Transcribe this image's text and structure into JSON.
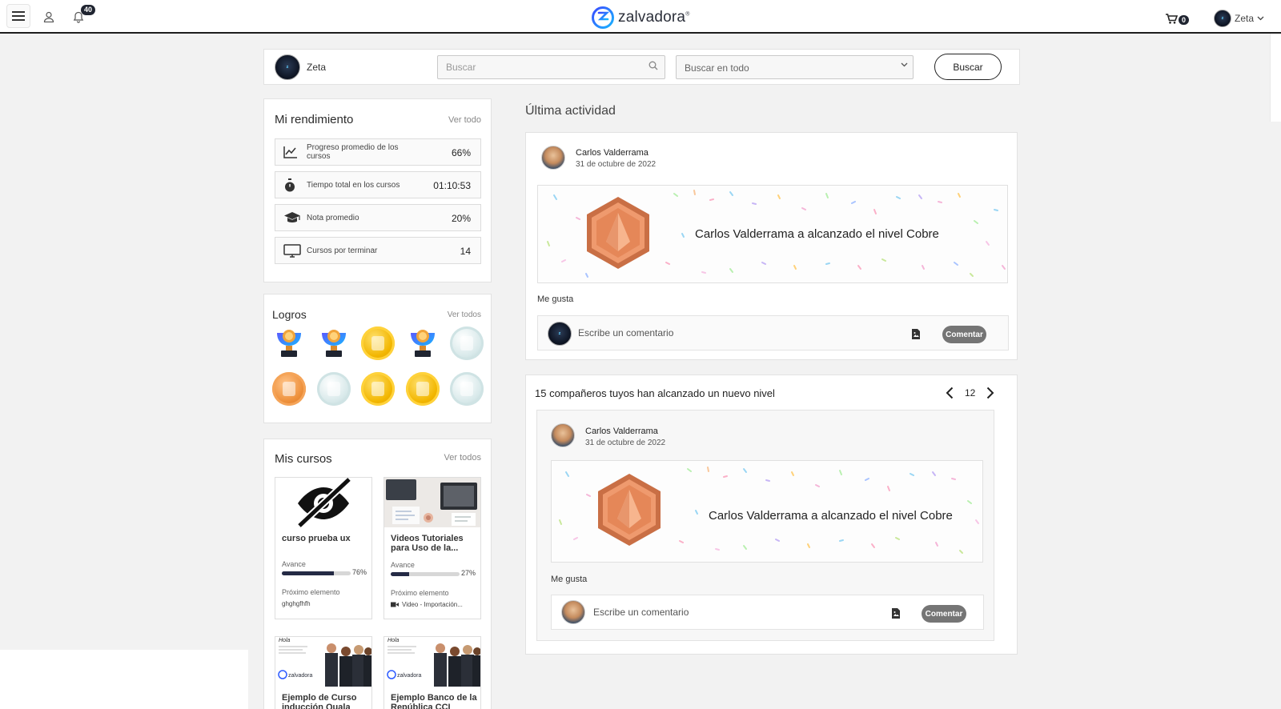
{
  "topbar": {
    "logo_text": "zalvadora",
    "logo_mark": "®",
    "notifications_count": "40",
    "cart_count": "0",
    "user_name": "Zeta"
  },
  "searchbar": {
    "user_name": "Zeta",
    "search_placeholder": "Buscar",
    "scope_selected": "Buscar en todo",
    "button_label": "Buscar"
  },
  "performance": {
    "title": "Mi rendimiento",
    "see_all": "Ver todo",
    "stats": [
      {
        "label": "Progreso promedio de los cursos",
        "value": "66%",
        "icon": "chart-line-icon"
      },
      {
        "label": "Tiempo total en los cursos",
        "value": "01:10:53",
        "icon": "stopwatch-icon"
      },
      {
        "label": "Nota promedio",
        "value": "20%",
        "icon": "graduation-cap-icon"
      },
      {
        "label": "Cursos por terminar",
        "value": "14",
        "icon": "monitor-icon"
      }
    ]
  },
  "achievements": {
    "title": "Logros",
    "see_all": "Ver todos",
    "badges": [
      "trophy",
      "trophy",
      "gold",
      "trophy",
      "silver",
      "bronze",
      "silver",
      "gold",
      "gold",
      "silver"
    ]
  },
  "courses": {
    "title": "Mis cursos",
    "see_all": "Ver todos",
    "items": [
      {
        "name": "curso prueba ux",
        "progress_label": "Avance",
        "progress": "76%",
        "progress_value": 0.76,
        "next_label": "Próximo elemento",
        "next_value": "ghghgfhfh"
      },
      {
        "name": "Videos Tutoriales para Uso de la...",
        "progress_label": "Avance",
        "progress": "27%",
        "progress_value": 0.27,
        "next_label": "Próximo elemento",
        "next_value": "Video - Importación..."
      },
      {
        "name": "Ejemplo de Curso inducción Quala",
        "thumb_brand": "zalvadora",
        "thumb_greeting": "Hola"
      },
      {
        "name": "Ejemplo Banco de la República CCI",
        "thumb_brand": "zalvadora",
        "thumb_greeting": "Hola"
      }
    ]
  },
  "activity": {
    "title": "Última actividad",
    "post": {
      "author": "Carlos Valderrama",
      "date": "31 de octubre de 2022",
      "banner_text": "Carlos Valderrama a alcanzado el nivel Cobre",
      "like_label": "Me gusta",
      "comment_placeholder": "Escribe un comentario",
      "comment_button": "Comentar"
    },
    "group": {
      "title": "15 compañeros tuyos han alcanzado un nuevo nivel",
      "page": "12",
      "post": {
        "author": "Carlos Valderrama",
        "date": "31 de octubre de 2022",
        "banner_text": "Carlos Valderrama a alcanzado el nivel Cobre",
        "like_label": "Me gusta",
        "comment_placeholder": "Escribe un comentario",
        "comment_button": "Comentar"
      }
    }
  },
  "colors": {
    "accent": "#1f2430",
    "bronze": "#e08a5a",
    "button_gray": "#757575"
  }
}
